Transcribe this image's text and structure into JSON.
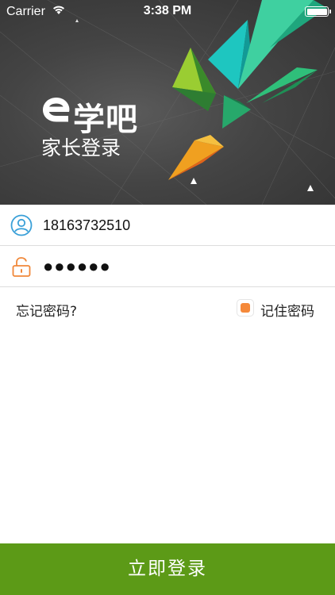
{
  "status_bar": {
    "carrier": "Carrier",
    "time": "3:38 PM",
    "wifi_icon": "wifi-icon",
    "battery_icon": "battery-icon"
  },
  "header": {
    "logo_icon": "e-logo-icon",
    "brand": "学吧",
    "subtitle": "家长登录"
  },
  "form": {
    "username": {
      "icon": "user-icon",
      "value": "18163732510"
    },
    "password": {
      "icon": "lock-icon",
      "value": "●●●●●●"
    },
    "forgot_password": "忘记密码?",
    "remember": {
      "label": "记住密码",
      "checked": true
    }
  },
  "login_button": "立即登录",
  "colors": {
    "accent_green": "#5c9a17",
    "checkbox_orange": "#f5893a",
    "user_icon_blue": "#3aa0d8",
    "lock_icon_orange": "#f0883a"
  }
}
